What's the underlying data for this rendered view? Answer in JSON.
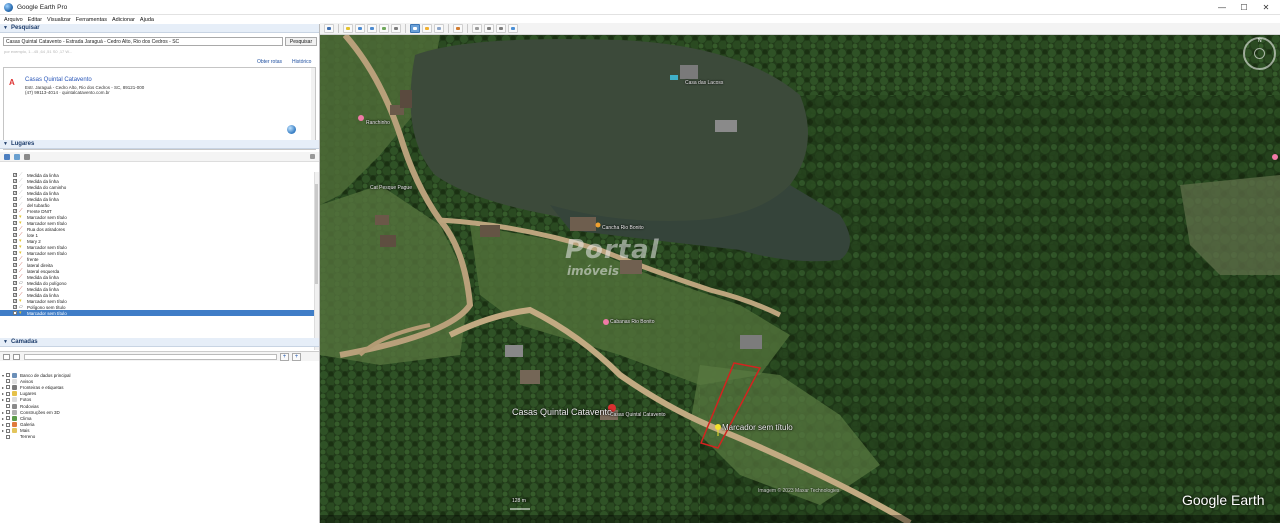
{
  "window": {
    "title": "Google Earth Pro",
    "controls": [
      "—",
      "☐",
      "✕"
    ]
  },
  "menu": [
    "Arquivo",
    "Editar",
    "Visualizar",
    "Ferramentas",
    "Adicionar",
    "Ajuda"
  ],
  "search": {
    "header": "Pesquisar",
    "value": "Casas Quintal Catavento - Estrada Jaraguá - Cedro Alto, Rio dos Cedros - SC",
    "button": "Pesquisar",
    "hint": "por exemplo, 1...45 ,64 ,51 S0 ,17 W...",
    "get_directions": "Obter rotas",
    "history": "Histórico",
    "result": {
      "title": "Casas Quintal Catavento",
      "address": "Estr. Jaraguá - Cedro Alto, Rio dos Cedros - SC, 89121-000",
      "contact": "(47) 99113-4014 · quintalcatavento.com.br"
    }
  },
  "places": {
    "header": "Lugares",
    "items": [
      {
        "label": "Medida da linha",
        "type": "line"
      },
      {
        "label": "Medida da linha",
        "type": "line"
      },
      {
        "label": "Medida do caminho",
        "type": "line"
      },
      {
        "label": "Medida da linha",
        "type": "line"
      },
      {
        "label": "Medida da linha",
        "type": "line"
      },
      {
        "label": "del tubarão",
        "type": "line"
      },
      {
        "label": "Frente DNIT",
        "type": "path"
      },
      {
        "label": "Marcador sem título",
        "type": "pin"
      },
      {
        "label": "Marcador sem título",
        "type": "pin"
      },
      {
        "label": "Rua dos atiradores",
        "type": "path"
      },
      {
        "label": "lote 1",
        "type": "path"
      },
      {
        "label": "Mary 2",
        "type": "pin"
      },
      {
        "label": "Marcador sem título",
        "type": "pin"
      },
      {
        "label": "Marcador sem título",
        "type": "pin"
      },
      {
        "label": "frente",
        "type": "path"
      },
      {
        "label": "lateral direita",
        "type": "path"
      },
      {
        "label": "lateral esquerda",
        "type": "path"
      },
      {
        "label": "Medida da linha",
        "type": "path"
      },
      {
        "label": "Medida do polígono",
        "type": "poly"
      },
      {
        "label": "Medida da linha",
        "type": "path"
      },
      {
        "label": "Medida da linha",
        "type": "path"
      },
      {
        "label": "Marcador sem título",
        "type": "pin"
      },
      {
        "label": "Polígono sem título",
        "type": "poly"
      },
      {
        "label": "Marcador sem título",
        "type": "pin",
        "selected": true
      }
    ]
  },
  "layers": {
    "header": "Camadas",
    "items": [
      {
        "label": "Banco de dados principal",
        "expander": "▾",
        "color": "#6b8fb8"
      },
      {
        "label": "Avisos",
        "expander": "",
        "color": "#e0e0e0"
      },
      {
        "label": "Fronteiras e etiquetas",
        "expander": "▸",
        "color": "#7a7a7a"
      },
      {
        "label": "Lugares",
        "expander": "▸",
        "color": "#e5c14a"
      },
      {
        "label": "Fotos",
        "expander": "▸",
        "color": "#dcdcdc"
      },
      {
        "label": "Rodovias",
        "expander": "",
        "color": "#8a8a8a"
      },
      {
        "label": "Construções em 3D",
        "expander": "▸",
        "color": "#b0b0b0"
      },
      {
        "label": "Clima",
        "expander": "▸",
        "color": "#5d9c4a"
      },
      {
        "label": "Galeria",
        "expander": "▸",
        "color": "#e07a3c"
      },
      {
        "label": "Mais",
        "expander": "▸",
        "color": "#e2c45b"
      },
      {
        "label": "Terreno",
        "expander": "",
        "color": "#ffffff"
      }
    ]
  },
  "map": {
    "labels": {
      "main_place": "Casas Quintal Catavento",
      "place_small": "Casas Quintal Catavento",
      "marker": "Marcador sem título",
      "cabanas": "Cabanas Rio Bonito",
      "cancha": "Cancha Rio Bonito",
      "cat_name1": "Cat Pesque Pague",
      "cat_name2": "Ranchinho",
      "cat_name3": "Casa das Lacoss",
      "scale": "128 m",
      "image_credit": "Imagem © 2023 Maxar Technologies"
    },
    "watermark": {
      "main": "Portal",
      "sub": "imóveis"
    },
    "logo": "Google Earth",
    "compass_n": "N"
  }
}
